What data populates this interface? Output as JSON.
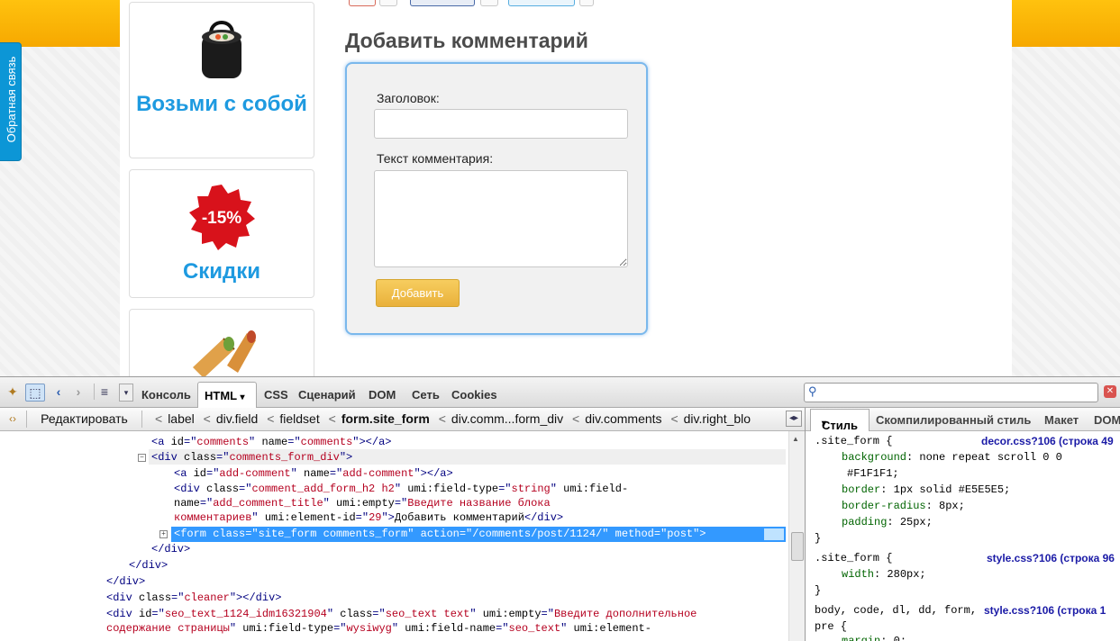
{
  "page": {
    "feedback_tab": "Обратная связь",
    "promos": [
      {
        "title": "Возьми с собой"
      },
      {
        "title": "Скидки",
        "badge": "-15%"
      },
      {
        "title": ""
      }
    ],
    "comment_form": {
      "heading": "Добавить комментарий",
      "title_label": "Заголовок:",
      "title_value": "",
      "text_label": "Текст комментария:",
      "text_value": "",
      "submit_label": "Добавить"
    }
  },
  "devtools": {
    "toolbar_tabs": [
      "Консоль",
      "HTML",
      "CSS",
      "Сценарий",
      "DOM",
      "Сеть",
      "Cookies"
    ],
    "html_tab_arrow": "▾",
    "search_placeholder": "",
    "edit_button": "Редактировать",
    "breadcrumbs": [
      "label",
      "div.field",
      "fieldset",
      "form.site_form",
      "div.comm...form_div",
      "div.comments",
      "div.right_blo"
    ],
    "active_breadcrumb": "form.site_form",
    "side_tabs": [
      "Стиль",
      "Скомпилированный стиль",
      "Макет",
      "DOM"
    ],
    "html_lines": [
      {
        "tag": "a",
        "attrs": [
          [
            "id",
            "comments"
          ],
          [
            "name",
            "comments"
          ]
        ],
        "close": "</a>"
      },
      {
        "tag": "div",
        "attrs": [
          [
            "class",
            "comments_form_div"
          ]
        ],
        "close": ""
      },
      {
        "tag": "a",
        "attrs": [
          [
            "id",
            "add-comment"
          ],
          [
            "name",
            "add-comment"
          ]
        ],
        "close": "</a>"
      },
      {
        "raw1": "<div class=\"comment_add_form_h2 h2\" umi:field-type=\"string\" umi:field-",
        "raw2": "name=\"add_comment_title\" umi:empty=\"Введите название блока",
        "raw3": "комментариев\" umi:element-id=\"29\">Добавить комментарий</div>"
      },
      {
        "selected": "<form class=\"site_form comments_form\" action=\"/comments/post/1124/\" method=\"post\">"
      },
      {
        "closing": "</div>"
      },
      {
        "closing": "</div>"
      },
      {
        "closing": "</div>"
      },
      {
        "tag": "div",
        "attrs": [
          [
            "class",
            "cleaner"
          ]
        ],
        "close": "</div>"
      },
      {
        "raw1": "<div id=\"seo_text_1124_idm16321904\" class=\"seo_text text\" umi:empty=\"Введите дополнительное",
        "raw2": "содержание страницы\" umi:field-type=\"wysiwyg\" umi:field-name=\"seo_text\" umi:element-"
      }
    ],
    "css_rules": [
      {
        "selector": ".site_form {",
        "source": "decor.css?106 (строка 49",
        "props": [
          [
            "background",
            "none repeat scroll 0 0"
          ],
          [
            "",
            "#F1F1F1;"
          ],
          [
            "border",
            "1px solid #E5E5E5;"
          ],
          [
            "border-radius",
            "8px;"
          ],
          [
            "padding",
            "25px;"
          ]
        ]
      },
      {
        "selector": ".site_form {",
        "source": "style.css?106 (строка 96",
        "props": [
          [
            "width",
            "280px;"
          ]
        ]
      },
      {
        "selector": "body, code, dl, dd, form,",
        "source": "style.css?106 (строка 1",
        "selector2": "pre {",
        "props": [
          [
            "margin",
            "0;"
          ]
        ]
      }
    ]
  }
}
